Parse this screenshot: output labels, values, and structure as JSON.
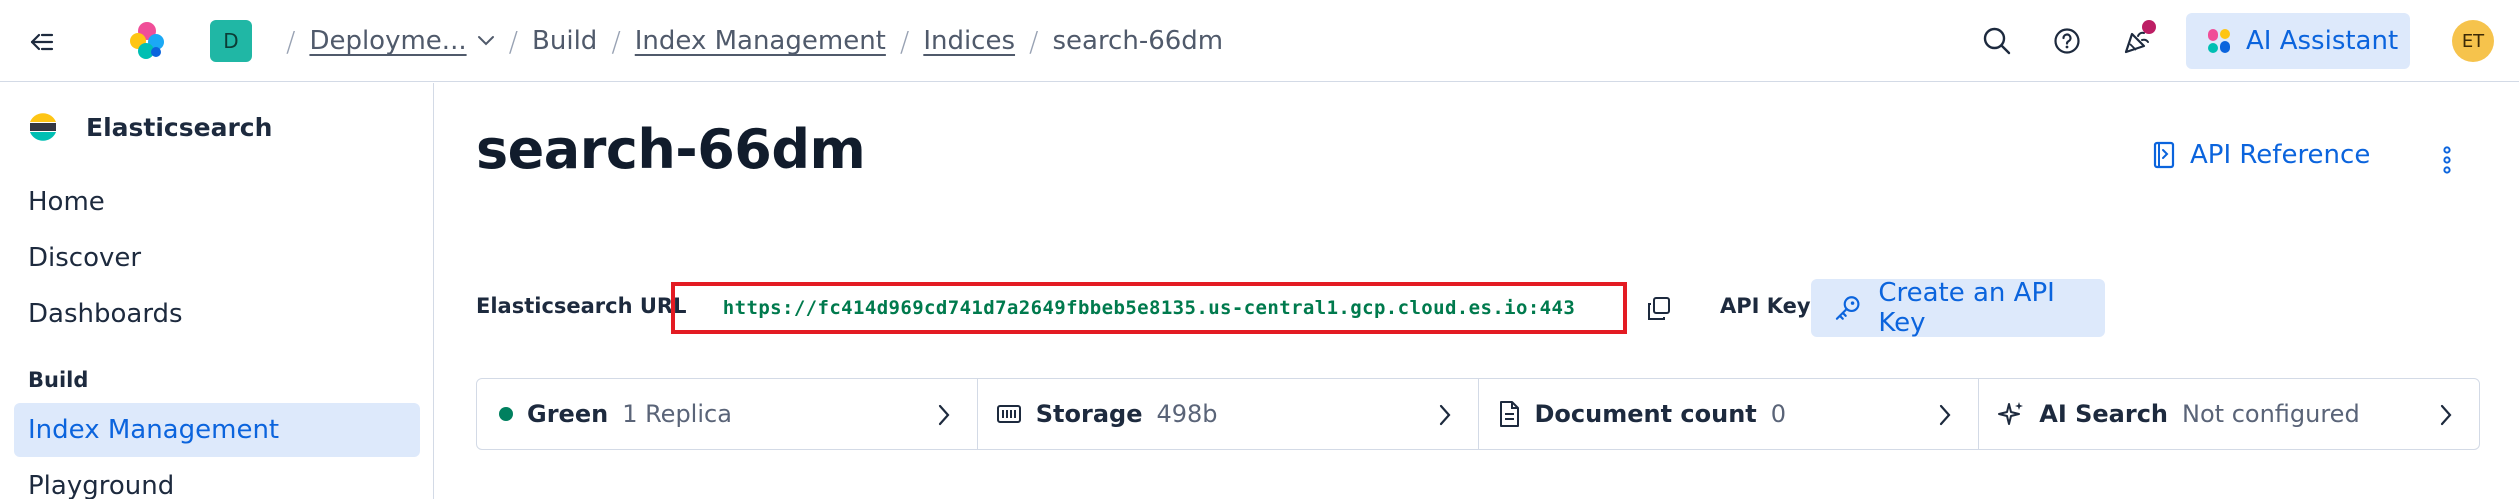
{
  "header": {
    "space_initial": "D",
    "breadcrumbs": {
      "deployment": "Deployme...",
      "build": "Build",
      "index_management": "Index Management",
      "indices": "Indices",
      "current": "search-66dm"
    },
    "ai_assistant_label": "AI Assistant",
    "user_initials": "ET"
  },
  "sidebar": {
    "brand": "Elasticsearch",
    "items": [
      "Home",
      "Discover",
      "Dashboards"
    ],
    "section_build": "Build",
    "build_items": [
      "Index Management",
      "Playground"
    ]
  },
  "main": {
    "title": "search-66dm",
    "api_reference": "API Reference",
    "es_url_label": "Elasticsearch URL",
    "es_url": "https://fc414d969cd741d7a2649fbbeb5e8135.us-central1.gcp.cloud.es.io:443",
    "api_key_label": "API Key",
    "create_api_key": "Create an API Key",
    "stats": [
      {
        "title": "Green",
        "value": "1 Replica",
        "icon": "status-dot"
      },
      {
        "title": "Storage",
        "value": "498b",
        "icon": "storage-icon"
      },
      {
        "title": "Document count",
        "value": "0",
        "icon": "document-icon"
      },
      {
        "title": "AI Search",
        "value": "Not configured",
        "icon": "sparkles-icon"
      }
    ]
  },
  "colors": {
    "accent": "#0b64dd",
    "accent_bg": "#dde9fb",
    "status_green": "#00805f",
    "url_green": "#007a4d",
    "highlight_red": "#e31b23"
  }
}
